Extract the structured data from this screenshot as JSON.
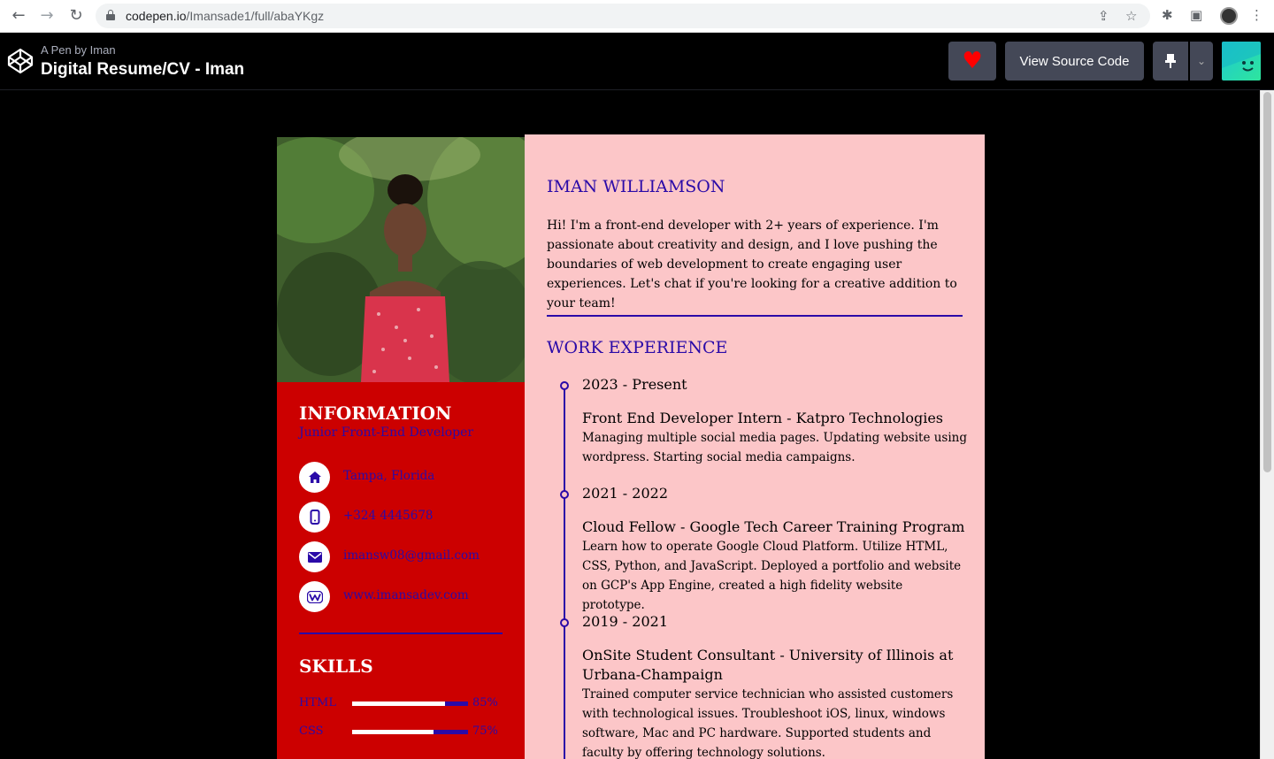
{
  "browser": {
    "url_host": "codepen.io",
    "url_path": "/Imansade1/full/abaYKgz",
    "back_icon": "←",
    "forward_icon": "→",
    "reload_icon": "↻",
    "share_icon": "⇪",
    "star_icon": "☆",
    "extensions_icon": "✱",
    "sidepanel_icon": "▣",
    "menu_icon": "⋮"
  },
  "header": {
    "byline": "A Pen by Iman",
    "title": "Digital Resume/CV - Iman",
    "heart_icon": "♥",
    "view_source_label": "View Source Code",
    "pin_icon": "📌",
    "dropdown_icon": "⌄"
  },
  "resume": {
    "info_title": "INFORMATION",
    "info_subtitle": "Junior Front-End Developer",
    "contacts": [
      {
        "icon": "home-icon",
        "text": "Tampa, Florida"
      },
      {
        "icon": "phone-icon",
        "text": "+324 4445678"
      },
      {
        "icon": "envelope-icon",
        "text": "imansw08@gmail.com"
      },
      {
        "icon": "website-icon",
        "text": "www.imansadev.com"
      }
    ],
    "skills_title": "SKILLS",
    "skills": [
      {
        "name": "HTML",
        "percent": "85%",
        "level": 0.8
      },
      {
        "name": "CSS",
        "percent": "75%",
        "level": 0.7
      }
    ],
    "name": "IMAN WILLIAMSON",
    "bio": "Hi! I'm a front-end developer with 2+ years of experience. I'm passionate about creativity and design, and I love pushing the boundaries of web development to create engaging user experiences. Let's chat if you're looking for a creative addition to your team!",
    "work_title": "WORK EXPERIENCE",
    "jobs": [
      {
        "date": "2023 - Present",
        "role": "Front End Developer Intern - Katpro Technologies",
        "description": "Managing multiple social media pages. Updating website using wordpress. Starting social media campaigns."
      },
      {
        "date": "2021 - 2022",
        "role": "Cloud Fellow - Google Tech Career Training Program",
        "description": "Learn how to operate Google Cloud Platform. Utilize HTML, CSS, Python, and JavaScript. Deployed a portfolio and website on GCP's App Engine, created a high fidelity website prototype."
      },
      {
        "date": "2019 - 2021",
        "role": "OnSite Student Consultant - University of Illinois at Urbana-Champaign",
        "description": "Trained computer service technician who assisted customers with technological issues. Troubleshoot iOS, linux, windows software, Mac and PC hardware. Supported students and faculty by offering technology solutions."
      }
    ]
  },
  "colors": {
    "left_panel": "#cc0000",
    "right_panel": "#fcc6c8",
    "accent": "#2a0aa8"
  }
}
